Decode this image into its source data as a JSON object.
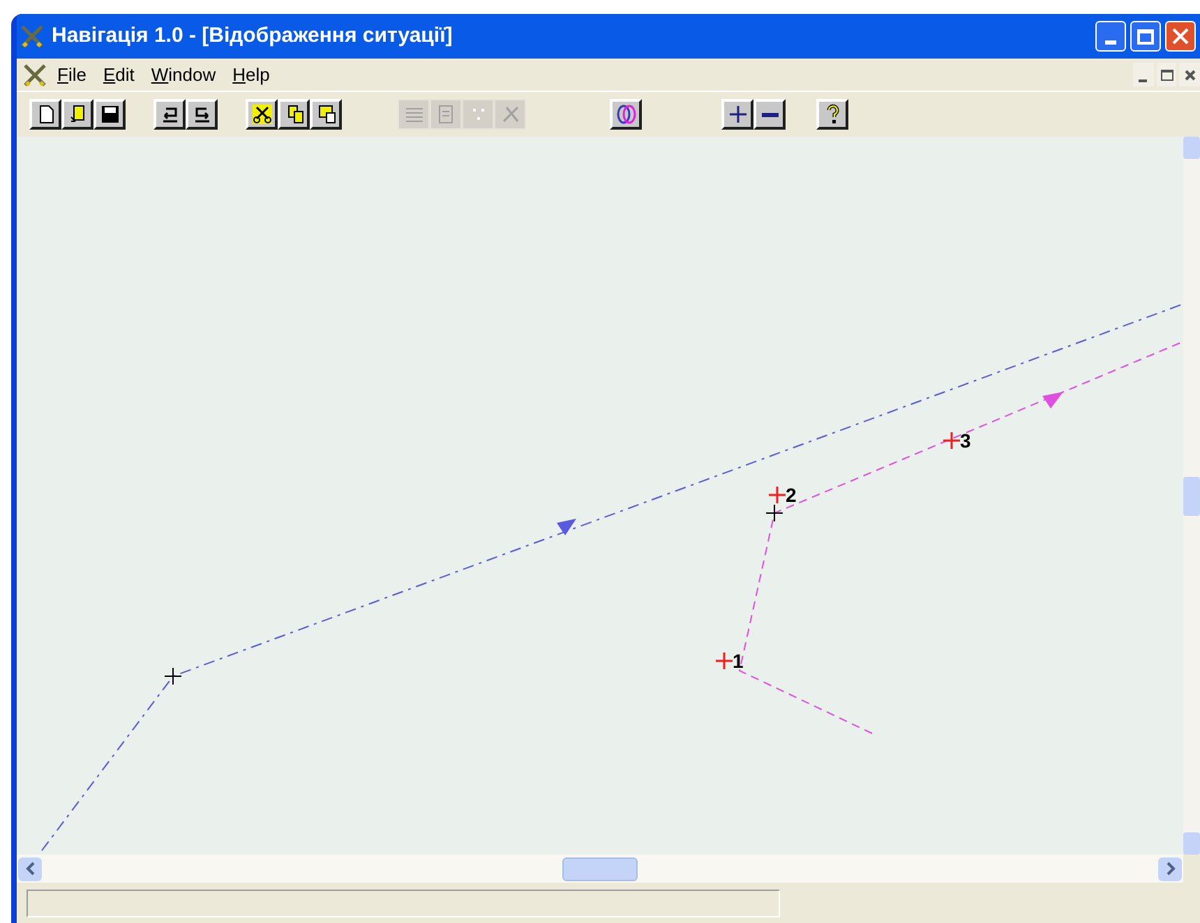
{
  "window": {
    "title": "Навігація 1.0 - [Відображення ситуації]"
  },
  "menu": [
    {
      "accel": "F",
      "rest": "ile"
    },
    {
      "accel": "E",
      "rest": "dit"
    },
    {
      "accel": "W",
      "rest": "indow"
    },
    {
      "accel": "H",
      "rest": "elp"
    }
  ],
  "toolbar": [
    {
      "buttons": [
        {
          "kind": "new",
          "disabled": false
        },
        {
          "kind": "open",
          "disabled": false
        },
        {
          "kind": "save",
          "disabled": false
        }
      ]
    },
    {
      "buttons": [
        {
          "kind": "undo",
          "disabled": false
        },
        {
          "kind": "redo",
          "disabled": false
        }
      ]
    },
    {
      "buttons": [
        {
          "kind": "cut",
          "disabled": false
        },
        {
          "kind": "copy",
          "disabled": false
        },
        {
          "kind": "paste",
          "disabled": false
        }
      ]
    },
    {
      "buttons": [
        {
          "kind": "lines",
          "disabled": true
        },
        {
          "kind": "list",
          "disabled": true
        },
        {
          "kind": "dots",
          "disabled": true
        },
        {
          "kind": "tool",
          "disabled": true
        }
      ]
    },
    {
      "buttons": [
        {
          "kind": "overlay",
          "disabled": false
        }
      ]
    },
    {
      "buttons": [
        {
          "kind": "zoom-in",
          "disabled": false
        },
        {
          "kind": "zoom-out",
          "disabled": false
        }
      ]
    },
    {
      "buttons": [
        {
          "kind": "help",
          "disabled": false
        }
      ]
    }
  ],
  "waypoints": [
    {
      "label": "1"
    },
    {
      "label": "2"
    },
    {
      "label": "3"
    }
  ]
}
